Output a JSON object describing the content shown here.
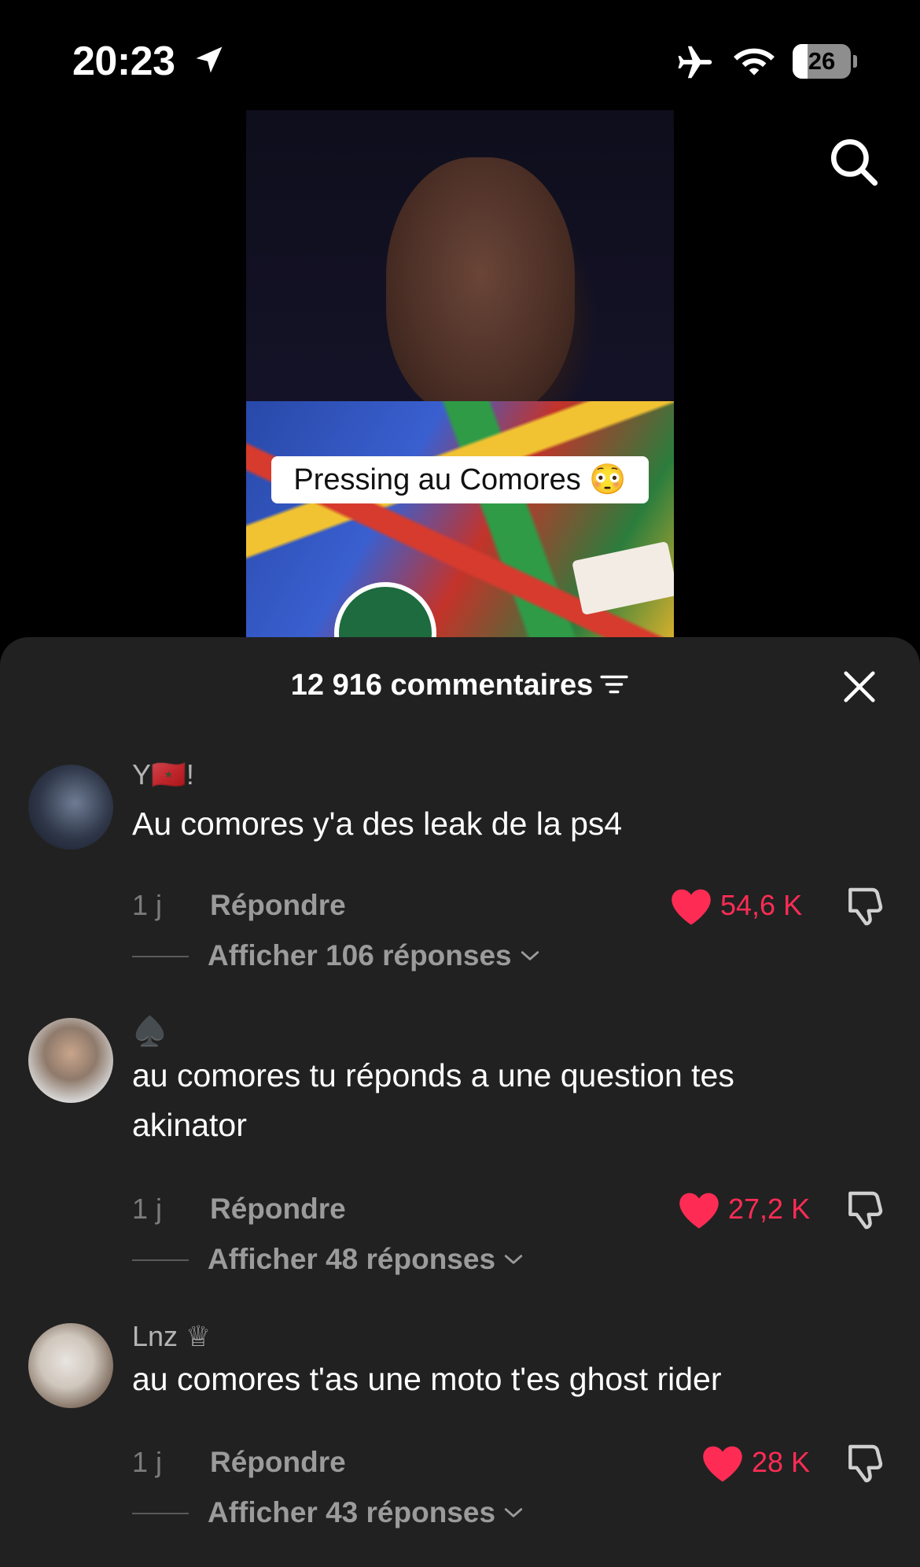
{
  "status_bar": {
    "time": "20:23",
    "battery": "26",
    "icons": [
      "location-arrow-icon",
      "airplane-icon",
      "wifi-icon",
      "battery-icon"
    ]
  },
  "video": {
    "caption": "Pressing au Comores 😳",
    "search_icon": "search-icon"
  },
  "sheet": {
    "count_label": "12 916 commentaires",
    "filter_icon": "filter-icon",
    "close_icon": "close-icon"
  },
  "comments": [
    {
      "username": "Y🇲🇦!",
      "text": "Au comores y'a des leak de la ps4",
      "age": "1 j",
      "reply_label": "Répondre",
      "likes": "54,6 K",
      "replies_label": "Afficher 106 réponses"
    },
    {
      "username": "♠️",
      "text": "au comores tu réponds a une question tes akinator",
      "age": "1 j",
      "reply_label": "Répondre",
      "likes": "27,2 K",
      "replies_label": "Afficher 48 réponses"
    },
    {
      "username": "Lnz ♕",
      "text": "au comores t'as une moto t'es ghost rider",
      "age": "1 j",
      "reply_label": "Répondre",
      "likes": "28 K",
      "replies_label": "Afficher 43 réponses"
    }
  ],
  "colors": {
    "background": "#000000",
    "sheet": "#212121",
    "like_red": "#fe2c55",
    "muted_text": "#9b9b9b"
  }
}
